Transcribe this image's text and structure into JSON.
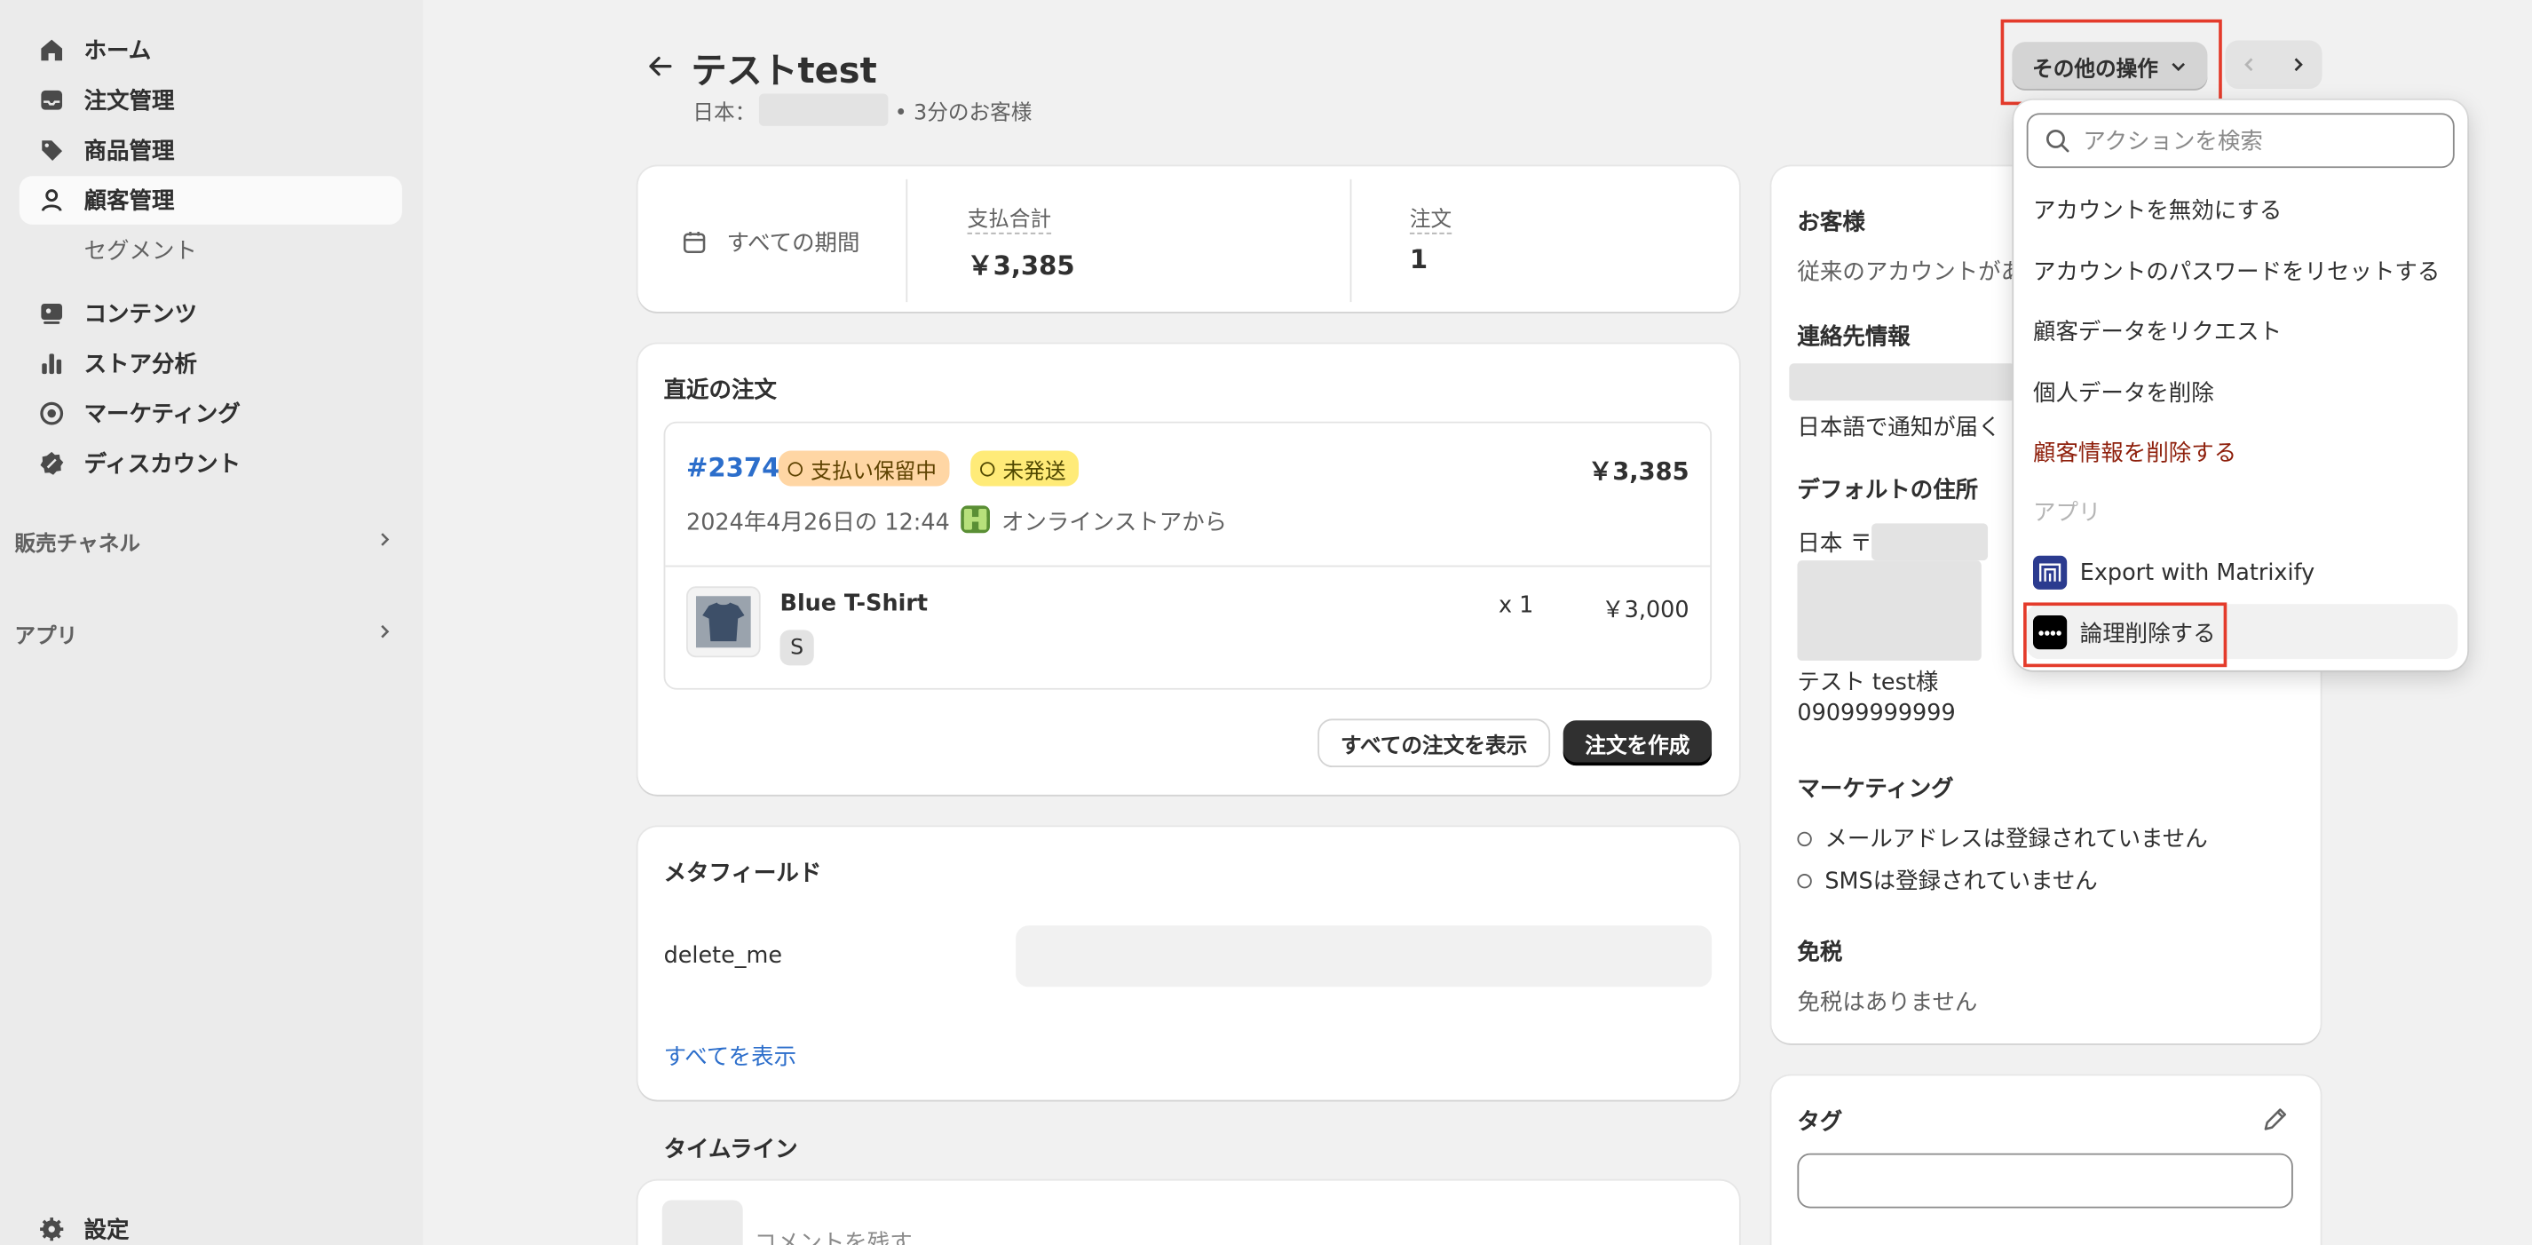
{
  "sidebar": {
    "items": [
      {
        "label": "ホーム",
        "icon": "home-icon"
      },
      {
        "label": "注文管理",
        "icon": "inbox-icon"
      },
      {
        "label": "商品管理",
        "icon": "tag-icon"
      },
      {
        "label": "顧客管理",
        "icon": "person-icon"
      },
      {
        "label": "コンテンツ",
        "icon": "content-icon"
      },
      {
        "label": "ストア分析",
        "icon": "bar-chart-icon"
      },
      {
        "label": "マーケティング",
        "icon": "target-icon"
      },
      {
        "label": "ディスカウント",
        "icon": "discount-icon"
      }
    ],
    "sub_item": "セグメント",
    "sales_channels": "販売チャネル",
    "apps": "アプリ",
    "settings": "設定"
  },
  "header": {
    "title": "テストtest",
    "country_prefix": "日本：",
    "customer_since": "• 3分のお客様",
    "more_actions": "その他の操作"
  },
  "stats": {
    "period": "すべての期間",
    "total_spent_label": "支払合計",
    "total_spent_value": "￥3,385",
    "orders_label": "注文",
    "orders_value": "1"
  },
  "recent_orders": {
    "title": "直近の注文",
    "order_number": "#2374",
    "payment_badge": "支払い保留中",
    "fulfillment_badge": "未発送",
    "order_total": "￥3,385",
    "order_date": "2024年4月26日の 12:44",
    "channel": "オンラインストアから",
    "item_name": "Blue T-Shirt",
    "item_variant": "S",
    "item_qty": "x 1",
    "item_price": "￥3,000",
    "view_all_orders": "すべての注文を表示",
    "create_order": "注文を作成"
  },
  "metafields": {
    "title": "メタフィールド",
    "field_name": "delete_me",
    "show_all": "すべてを表示"
  },
  "timeline": {
    "title": "タイムライン",
    "comment_placeholder": "コメントを残す"
  },
  "customer_panel": {
    "title": "お客様",
    "legacy_text": "従来のアカウントがあ",
    "contact_title": "連絡先情報",
    "notify_text": "日本語で通知が届く",
    "address_title": "デフォルトの住所",
    "address_line": "日本 〒",
    "address_name": "テスト test様",
    "phone": "09099999999",
    "marketing_title": "マーケティング",
    "email_status": "メールアドレスは登録されていません",
    "sms_status": "SMSは登録されていません",
    "tax_title": "免税",
    "tax_value": "免税はありません",
    "tags_title": "タグ"
  },
  "dropdown": {
    "search_placeholder": "アクションを検索",
    "items": [
      "アカウントを無効にする",
      "アカウントのパスワードをリセットする",
      "顧客データをリクエスト",
      "個人データを削除"
    ],
    "danger_item": "顧客情報を削除する",
    "apps_section": "アプリ",
    "app1": "Export with Matrixify",
    "app2": "論理削除する"
  },
  "colors": {
    "accent_highlight": "#e43b2b",
    "link_blue": "#2c6ecb",
    "payment_badge_bg": "#ffd6a4",
    "fulfillment_badge_bg": "#ffeb78",
    "danger_text": "#8e1f0b",
    "matrixify_bg": "#2b3b8f"
  }
}
